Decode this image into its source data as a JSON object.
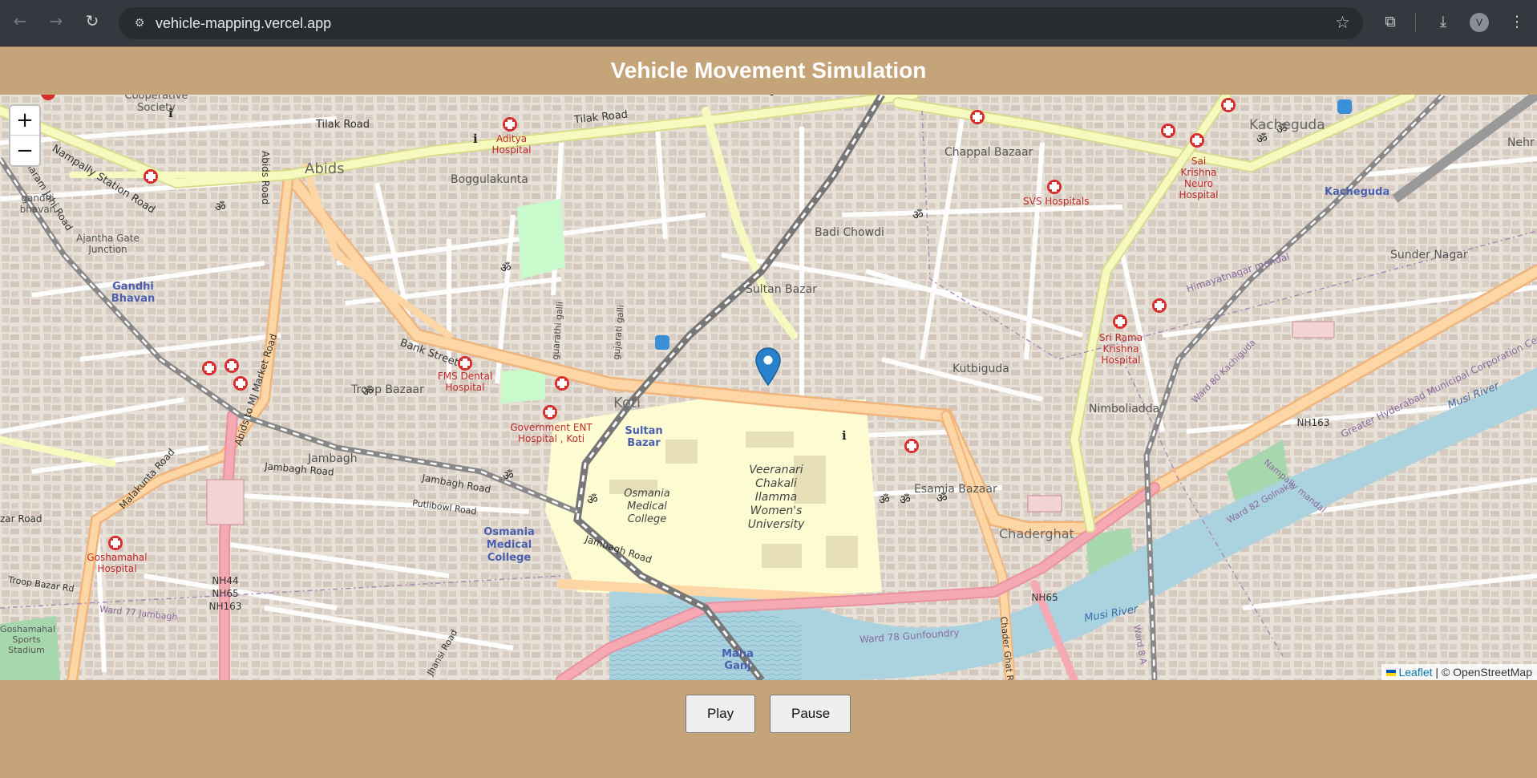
{
  "browser": {
    "url": "vehicle-mapping.vercel.app",
    "profile_initial": "V",
    "icons": [
      "back-icon",
      "forward-icon",
      "reload-icon",
      "site-info-icon",
      "bookmark-star-icon",
      "extensions-icon",
      "download-icon",
      "menu-icon"
    ]
  },
  "page": {
    "title": "Vehicle Movement Simulation"
  },
  "map": {
    "zoom_in": "+",
    "zoom_out": "−",
    "attribution_leaflet": "Leaflet",
    "attribution_rest": "| © OpenStreetMap",
    "marker_color": "#2a81cb",
    "labels": {
      "cooperative_society": "Cooperative Society",
      "tilak_road_1": "Tilak Road",
      "tilak_road_2": "Tilak Road",
      "aditya_hospital": "Aditya Hospital",
      "abids": "Abids",
      "boggulakunta": "Boggulakunta",
      "nampally_station_road": "Nampally Station Road",
      "mukharam_jahi_road": "Mukharam Jahi Road",
      "gandhi_bhavan_statue": "gandhi bhavan",
      "ajantha_gate": "Ajantha Gate Junction",
      "gandhi_bhavan": "Gandhi Bhavan",
      "abids_road": "Abids Road",
      "abids_to_mj_market": "Abids to MJ Market Road",
      "bank_street": "Bank Street",
      "troop_bazaar": "Troop Bazaar",
      "fms_dental": "FMS Dental Hospital",
      "guarathi_galli": "guarathi galli",
      "gujarati_galli": "gujarati galli",
      "koti": "Koti",
      "govt_ent": "Government ENT Hospital , Koti",
      "sultan_bazar_bus": "Sultan Bazar",
      "sultan_bazar": "Sultan Bazar",
      "badi_chowdi": "Badi Chowdi",
      "chappal_bazaar": "Chappal Bazaar",
      "svs_hospitals": "SVS Hospitals",
      "kacheguda": "Kacheguda",
      "kacheguda_station": "Kacheguda",
      "sai_krishna": "Sai Krishna Neuro Hospital",
      "sunder_nagar": "Sunder Nagar",
      "himayatnagar_mandal": "Himayatnagar mandal",
      "sri_rama_krishna": "Sri Rama Krishna Hospital",
      "kutbiguda": "Kutbiguda",
      "nimboliadda": "Nimboliadda",
      "esamia_bazaar": "Esamia Bazaar",
      "veeranari": "Veeranari Chakali Ilamma Women's University",
      "osmania_medical_college_campus": "Osmania Medical College",
      "osmania_medical_college": "Osmania Medical College",
      "jambagh": "Jambagh",
      "jambagh_road_1": "Jambagh Road",
      "jambagh_road_2": "Jambagh Road",
      "jambagh_road_3": "Jambagh Road",
      "putlibowl_road": "Putlibowl Road",
      "malakunta_road": "Malakunta Road",
      "goshamahal_hospital": "Goshamahal Hospital",
      "zar_road": "zar Road",
      "troop_bazar_rd": "Troop Bazar Rd",
      "goshamahal_stadium": "Goshamahal Sports Stadium",
      "ward_77": "Ward 77 Jambagh",
      "nh_badge": "NH44 NH65 NH163",
      "chaderghat": "Chaderghat",
      "nh163": "NH163",
      "nh65": "NH65",
      "ward_78": "Ward 78 Gunfoundry",
      "musi_river": "Musi River",
      "musi_river_2": "Musi River",
      "ghmc": "Greater Hyderabad Municipal Corporation Central Zone",
      "ward_80": "Ward 80 Kachiguda",
      "ward_82": "Ward 82 Golnaka",
      "nampally_mandal": "Nampally mandal",
      "maha_ganj": "Maha Ganj",
      "nehr": "Nehr",
      "ward_8a": "Ward 8 A",
      "chader_ghat_rd": "Chader Ghat R",
      "jhansi_road": "Jhansi Road"
    }
  },
  "controls": {
    "play_label": "Play",
    "pause_label": "Pause"
  }
}
